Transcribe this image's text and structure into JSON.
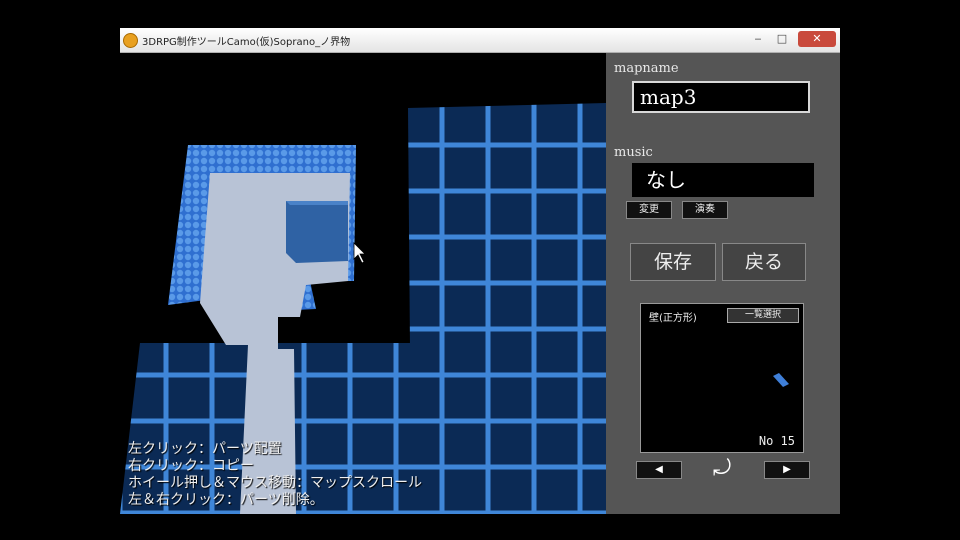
{
  "window": {
    "title": "3DRPG制作ツールCamo(仮)Soprano_ノ界物",
    "minimize": "‒",
    "maximize": "□",
    "close": "✕"
  },
  "icons": {
    "app": "app-icon",
    "cursor": "mouse-cursor-icon",
    "rotate": "rotate-arrow-icon",
    "prev": "left-arrow-icon",
    "next": "right-arrow-icon"
  },
  "colors": {
    "grid_fill": "#0b2a55",
    "grid_line": "#3f86d8",
    "floor": "#b8c3d6",
    "wall": "#3f7fd8",
    "block": "#2f62a4",
    "panel": "#555555"
  },
  "help": {
    "line1": "左クリック：パーツ配置",
    "line2": "右クリック：コピー",
    "line3": "ホイール押し＆マウス移動：マップスクロール",
    "line4": "左＆右クリック：パーツ削除。"
  },
  "panel": {
    "mapname_label": "mapname",
    "mapname_value": "map3",
    "music_label": "music",
    "music_value": "なし",
    "change_button": "変更",
    "play_button": "演奏",
    "save_button": "保存",
    "back_button": "戻る",
    "parts_name": "壁(正方形)",
    "parts_list_button": "一覧選択",
    "parts_no": "No 15",
    "prev_button": "◀",
    "next_button": "▶",
    "rotate_button": "⤾"
  }
}
